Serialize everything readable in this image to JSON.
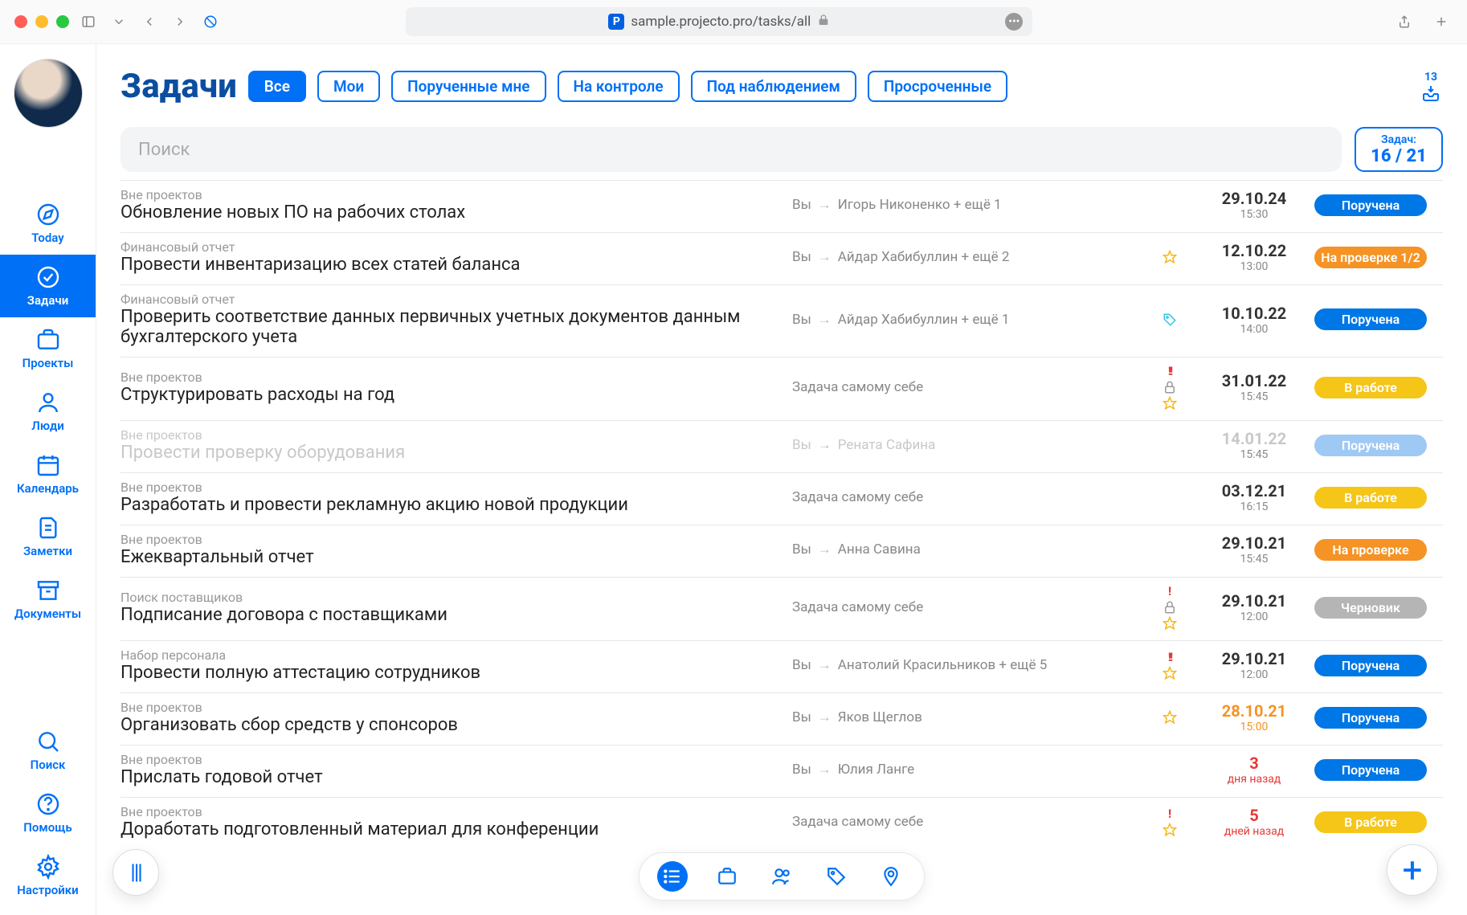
{
  "browser": {
    "url": "sample.projecto.pro/tasks/all"
  },
  "sidebar": {
    "items": [
      {
        "label": "Today"
      },
      {
        "label": "Задачи"
      },
      {
        "label": "Проекты"
      },
      {
        "label": "Люди"
      },
      {
        "label": "Календарь"
      },
      {
        "label": "Заметки"
      },
      {
        "label": "Документы"
      }
    ],
    "bottom": [
      {
        "label": "Поиск"
      },
      {
        "label": "Помощь"
      },
      {
        "label": "Настройки"
      }
    ]
  },
  "header": {
    "title": "Задачи",
    "filters": [
      "Все",
      "Мои",
      "Порученные мне",
      "На контроле",
      "Под наблюдением",
      "Просроченные"
    ],
    "inbox_count": "13"
  },
  "search": {
    "placeholder": "Поиск"
  },
  "counter": {
    "label": "Задач:",
    "value": "16 / 21"
  },
  "tasks": [
    {
      "project": "Вне проектов",
      "title": "Обновление новых ПО на рабочих столах",
      "assign_prefix": "Вы",
      "assign_rest": "Игорь Никоненко + ещё 1",
      "date": "29.10.24",
      "time": "15:30",
      "status": "Поручена",
      "status_class": "st-blue",
      "icons": []
    },
    {
      "project": "Финансовый отчет",
      "title": "Провести инвентаризацию всех статей баланса",
      "assign_prefix": "Вы",
      "assign_rest": "Айдар Хабибуллин + ещё 2",
      "date": "12.10.22",
      "time": "13:00",
      "status": "На проверке 1/2",
      "status_class": "st-orange",
      "icons": [
        "star"
      ]
    },
    {
      "project": "Финансовый отчет",
      "title": "Проверить соответствие данных первичных учетных документов данным бухгалтерского учета",
      "assign_prefix": "Вы",
      "assign_rest": "Айдар Хабибуллин + ещё 1",
      "date": "10.10.22",
      "time": "14:00",
      "status": "Поручена",
      "status_class": "st-blue",
      "icons": [
        "tag"
      ]
    },
    {
      "project": "Вне проектов",
      "title": "Структурировать расходы на год",
      "assign_self": "Задача самому себе",
      "date": "31.01.22",
      "time": "15:45",
      "status": "В работе",
      "status_class": "st-yellow",
      "icons": [
        "dbl",
        "lock",
        "star"
      ]
    },
    {
      "project": "Вне проектов",
      "title": "Провести проверку оборудования",
      "assign_prefix": "Вы",
      "assign_rest": "Рената Сафина",
      "date": "14.01.22",
      "time": "15:45",
      "status": "Поручена",
      "status_class": "st-lightblue",
      "faded": true,
      "icons": []
    },
    {
      "project": "Вне проектов",
      "title": "Разработать и провести рекламную акцию новой продукции",
      "assign_self": "Задача самому себе",
      "date": "03.12.21",
      "time": "16:15",
      "status": "В работе",
      "status_class": "st-yellow",
      "icons": []
    },
    {
      "project": "Вне проектов",
      "title": "Ежеквартальный отчет",
      "assign_prefix": "Вы",
      "assign_rest": "Анна Савина",
      "date": "29.10.21",
      "time": "15:45",
      "status": "На проверке",
      "status_class": "st-orange",
      "icons": []
    },
    {
      "project": "Поиск поставщиков",
      "title": "Подписание договора с поставщиками",
      "assign_self": "Задача самому себе",
      "date": "29.10.21",
      "time": "12:00",
      "status": "Черновик",
      "status_class": "st-gray",
      "icons": [
        "sgl",
        "lock",
        "star"
      ]
    },
    {
      "project": "Набор персонала",
      "title": "Провести полную аттестацию сотрудников",
      "assign_prefix": "Вы",
      "assign_rest": "Анатолий Красильников + ещё 5",
      "date": "29.10.21",
      "time": "12:00",
      "status": "Поручена",
      "status_class": "st-blue",
      "icons": [
        "dbl",
        "star"
      ]
    },
    {
      "project": "Вне проектов",
      "title": "Организовать сбор средств у спонсоров",
      "assign_prefix": "Вы",
      "assign_rest": "Яков Щеглов",
      "date": "28.10.21",
      "time": "15:00",
      "status": "Поручена",
      "status_class": "st-blue",
      "date_color": "orange",
      "icons": [
        "star"
      ]
    },
    {
      "project": "Вне проектов",
      "title": "Прислать годовой отчет",
      "assign_prefix": "Вы",
      "assign_rest": "Юлия Ланге",
      "date": "3",
      "time": "дня назад",
      "status": "Поручена",
      "status_class": "st-blue",
      "date_color": "red",
      "icons": []
    },
    {
      "project": "Вне проектов",
      "title": "Доработать подготовленный материал для конференции",
      "assign_self": "Задача самому себе",
      "date": "5",
      "time": "дней назад",
      "status": "В работе",
      "status_class": "st-yellow",
      "date_color": "red",
      "icons": [
        "sgl",
        "star"
      ]
    }
  ]
}
